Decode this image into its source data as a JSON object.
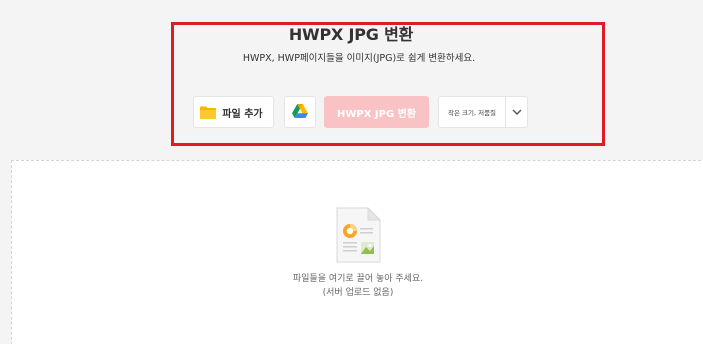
{
  "header": {
    "title": "HWPX JPG 변환",
    "subtitle": "HWPX, HWP페이지들을 이미지(JPG)로 쉽게 변환하세요."
  },
  "toolbar": {
    "add_file_label": "파일 추가",
    "add_file_icon": "folder-icon",
    "gdrive_icon": "google-drive-icon",
    "convert_label": "HWPX JPG 변환",
    "quality_selected": "작은 크기, 저품질",
    "quality_arrow_icon": "chevron-down-icon"
  },
  "dropzone": {
    "icon": "document-image-icon",
    "line1": "파일들을 여기로 끌어 놓아 주세요.",
    "line2": "(서버 업로드 없음)"
  },
  "colors": {
    "highlight": "#e01b24",
    "convert_disabled_bg": "#f9c3c6",
    "folder_yellow": "#f7b500"
  }
}
